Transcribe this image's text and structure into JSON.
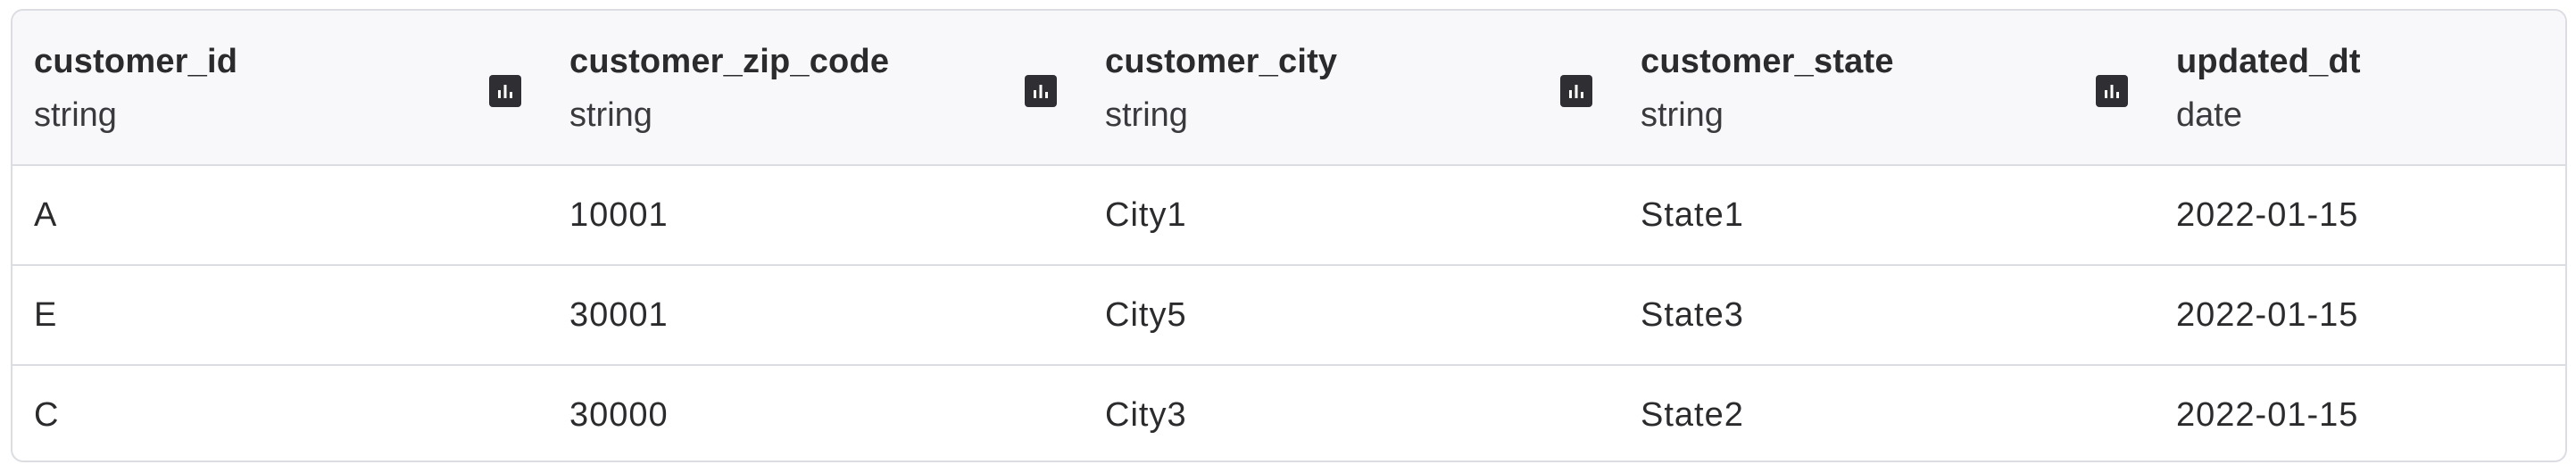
{
  "columns": [
    {
      "name": "customer_id",
      "type": "string",
      "stats_icon": "bar-chart-icon"
    },
    {
      "name": "customer_zip_code",
      "type": "string",
      "stats_icon": "bar-chart-icon"
    },
    {
      "name": "customer_city",
      "type": "string",
      "stats_icon": "bar-chart-icon"
    },
    {
      "name": "customer_state",
      "type": "string",
      "stats_icon": "bar-chart-icon"
    },
    {
      "name": "updated_dt",
      "type": "date"
    }
  ],
  "rows": [
    [
      "A",
      "10001",
      "City1",
      "State1",
      "2022-01-15"
    ],
    [
      "E",
      "30001",
      "City5",
      "State3",
      "2022-01-15"
    ],
    [
      "C",
      "30000",
      "City3",
      "State2",
      "2022-01-15"
    ]
  ],
  "colors": {
    "header_bg": "#f8f8fa",
    "border": "#dcdde3",
    "icon_bg": "#2f2f33"
  }
}
